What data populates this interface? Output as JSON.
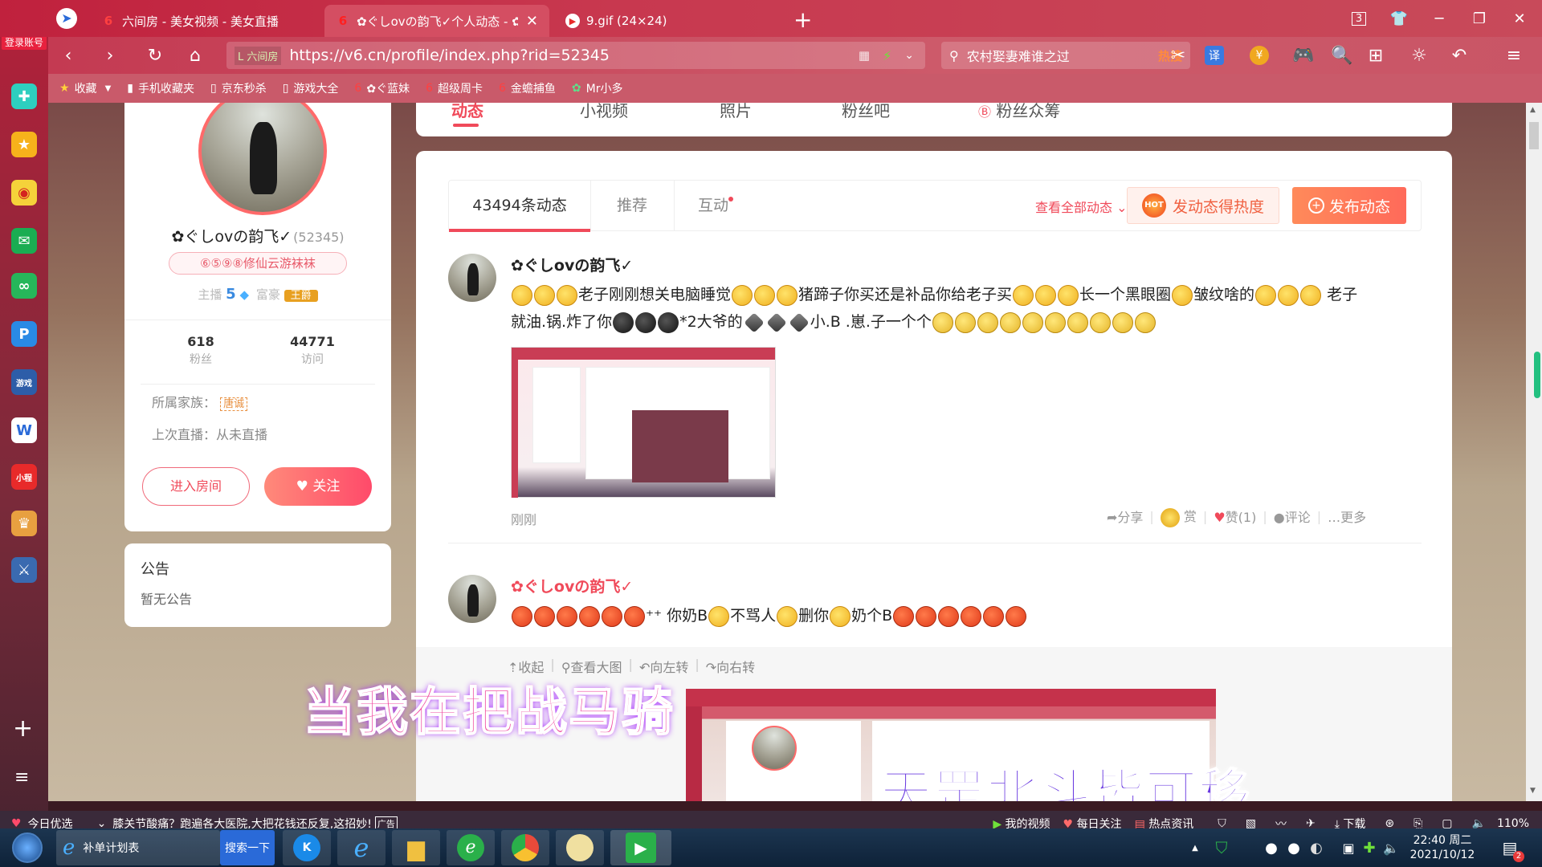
{
  "tabs": [
    {
      "label": "六间房 - 美女视频 - 美女直播",
      "active": false
    },
    {
      "label": "✿ぐしovの韵飞✓个人动态 - ✿",
      "active": true
    },
    {
      "label": "9.gif (24×24)",
      "active": false
    }
  ],
  "window": {
    "tab_count": "3"
  },
  "nav": {
    "site_tag": "L 六间房",
    "url": "https://v6.cn/profile/index.php?rid=52345",
    "search_text": "农村娶妻难谁之过",
    "search_hot": "热搜"
  },
  "bookmarks": [
    "收藏",
    "手机收藏夹",
    "京东秒杀",
    "游戏大全",
    "✿ぐ蓝妹",
    "超级周卡",
    "金蟾捕鱼",
    "Mr小多"
  ],
  "sidebar": {
    "login_label": "登录账号"
  },
  "profile": {
    "name": "✿ぐしovの韵飞✓",
    "rid": "(52345)",
    "badge": "⑥⑤⑨⑧修仙云游袜袜",
    "host_label": "主播",
    "host_level": "5",
    "rich_label": "富豪",
    "rich_title": "王爵",
    "fans_count": "618",
    "fans_label": "粉丝",
    "visits_count": "44771",
    "visits_label": "访问",
    "family_label": "所属家族：",
    "family_name": "唐诚",
    "last_live_label": "上次直播：从未直播",
    "enter_room": "进入房间",
    "follow": "关注"
  },
  "notice": {
    "title": "公告",
    "content": "暂无公告"
  },
  "top_tabs": [
    "动态",
    "小视频",
    "照片",
    "粉丝吧",
    "粉丝众筹"
  ],
  "feed_tabs": {
    "count_tab": "43494条动态",
    "recommend": "推荐",
    "interact": "互动",
    "view_all": "查看全部动态",
    "heat_button": "发动态得热度",
    "publish_button": "发布动态"
  },
  "posts": [
    {
      "author": "✿ぐしovの韵飞✓",
      "text1": "老子刚刚想关电脑睡觉",
      "text2": "猪蹄子你买还是补品你给老子买",
      "text3": "长一个黑眼圈",
      "text4": "皱纹啥的",
      "text5": "老子",
      "text6": "就油.锅.炸了你",
      "text7": "*2大爷的",
      "text8": "小.B .崽.子一个个",
      "time": "刚刚",
      "share": "分享",
      "reward": "赏",
      "like": "赞(1)",
      "comment": "评论",
      "more": "更多"
    },
    {
      "author": "✿ぐしovの韵飞✓",
      "text1": "⁺⁺ 你奶B",
      "text2": "不骂人",
      "text3": "删你",
      "text4": "奶个B",
      "toolbar": [
        "收起",
        "查看大图",
        "向左转",
        "向右转"
      ]
    }
  ],
  "overlay": {
    "line1": "当我在把战马骑",
    "line2": "天罡北斗皆可移"
  },
  "statusbar": {
    "left_label": "今日优选",
    "news": "膝关节酸痛？跑遍各大医院,大把花钱还反复,这招妙!",
    "items": [
      "我的视频",
      "每日关注",
      "热点资讯"
    ],
    "download": "下载",
    "zoom": "110%"
  },
  "taskbar": {
    "app_label": "补单计划表",
    "search_btn": "搜索一下",
    "time": "22:40 周二",
    "date": "2021/10/12",
    "notif": "2"
  }
}
